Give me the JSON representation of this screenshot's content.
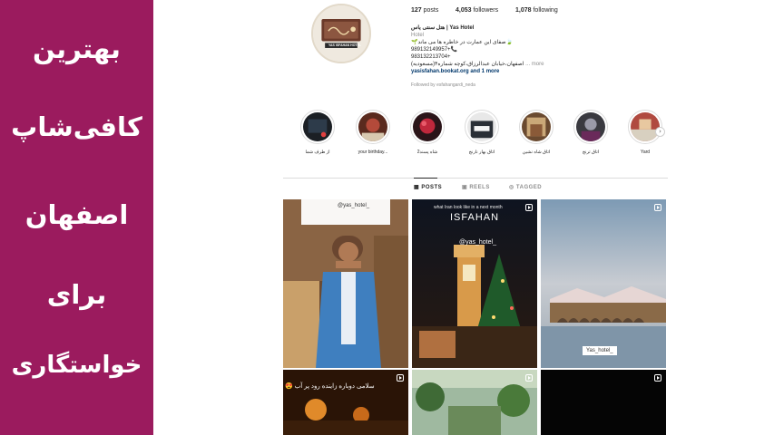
{
  "banner": {
    "lines": [
      "بهترین",
      "کافی‌شاپ",
      "اصفهان",
      "برای",
      "خواستگاری"
    ]
  },
  "profile": {
    "posts_count": "127",
    "posts_label": "posts",
    "followers_count": "4,053",
    "followers_label": "followers",
    "following_count": "1,078",
    "following_label": "following",
    "name": "هتل سنتی یاس | Yas Hotel",
    "category": "Hotel",
    "bio_line1": "🌱صفای این عمارت در خاطره ها می ماند🍃",
    "bio_line2": "989132149957+📞",
    "bio_line3": "983132213704+",
    "bio_line4": "(اصفهان،خیابان عبدالرزاق،کوچه شماره۴(مسعودیه",
    "bio_more": "... more",
    "link": "yasisfahan.bookat.org and 1 more",
    "followed_by": "Followed by esfahangardi_neda",
    "logo_text": "YAS ISFAHAN HOTEL"
  },
  "highlights": [
    {
      "label": "از طرف شما"
    },
    {
      "label": "your birthday..."
    },
    {
      "label": "شاه پسند2"
    },
    {
      "label": "اتاق بهار نارنج"
    },
    {
      "label": "اتاق شاه نشین"
    },
    {
      "label": "اتاق ترنج"
    },
    {
      "label": "Yard"
    }
  ],
  "tabs": {
    "posts": "POSTS",
    "reels": "REELS",
    "tagged": "TAGGED"
  },
  "posts": {
    "p1_tag": "@yas_hotel_",
    "p2_caption": "what Iran look like in a next month",
    "p2_title": "ISFAHAN",
    "p2_tag": "@yas_hotel_",
    "p3_tag": "Yas_hotel_",
    "p4_caption": "سلامی دوباره زاینده رود پر آب 😍"
  },
  "colors": {
    "banner": "#9b1b5e",
    "link": "#00376b"
  }
}
